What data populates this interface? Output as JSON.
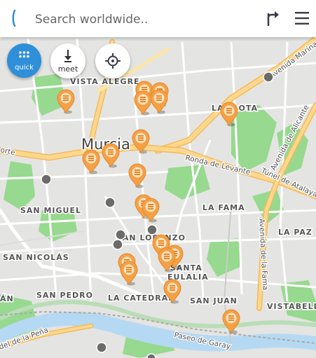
{
  "search": {
    "placeholder": "Search worldwide.."
  },
  "buttons": {
    "quick_label": "quick",
    "meet_label": "meet"
  },
  "icons": {
    "back": "back-arrow-icon",
    "directions": "directions-icon",
    "menu": "hamburger-menu-icon",
    "quick": "apps-grid-icon",
    "meet": "meet-icon",
    "locate": "crosshair-locate-icon"
  },
  "colors": {
    "accent": "#2f8fd8",
    "poi_marker": "#f5a045",
    "park": "#8fd88a",
    "major_road": "#f7c870",
    "river": "#b5d9f2"
  },
  "map_labels": {
    "vista_alegre": "VISTA ALEGRE",
    "murcia": "Murcia",
    "la_flota": "LA FLOTA",
    "san_miguel": "SAN MIGUEL",
    "la_fama": "LA FAMA",
    "la_paz": "LA PAZ",
    "san_lorenzo": "SAN LORENZO",
    "san_nicolas": "SAN NICOLÁS",
    "santa_eulalia_1": "SANTA",
    "santa_eulalia_2": "EULALIA",
    "san_pedro": "SAN PEDRO",
    "la_catedral": "LA CATEDRAL",
    "san_juan": "SAN JUAN",
    "vistabella": "VISTABELLA",
    "san_anton_partial": "ÁN",
    "ronda_levante": "Ronda de Levante",
    "tunel_atalayas": "Túnel de Atalayas",
    "avenida_marina": "Avenida Marina",
    "avenida_alicante": "Avenida de Alicante",
    "avenida_fama": "Avenida de la Fama",
    "paseo_garay": "Paseo de Garay",
    "la_pena": "del de la Peña",
    "ronda_norte_partial": "orte"
  }
}
